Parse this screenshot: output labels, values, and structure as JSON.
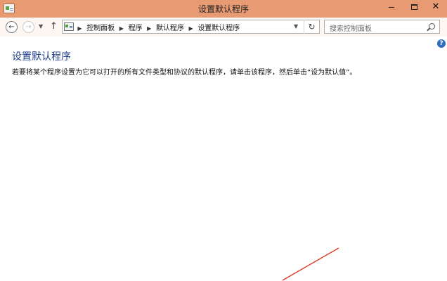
{
  "window": {
    "title": "设置默认程序",
    "minimize_glyph": "",
    "close_glyph": "✕"
  },
  "nav": {
    "back_glyph": "←",
    "forward_glyph": "→",
    "history_dropdown_glyph": "▼",
    "up_glyph": "↑"
  },
  "address": {
    "icon": "control-panel-icon",
    "breadcrumbs": [
      "控制面板",
      "程序",
      "默认程序",
      "设置默认程序"
    ],
    "separator_glyph": "▶",
    "dropdown_glyph": "▼",
    "refresh_glyph": "↻"
  },
  "search": {
    "placeholder": "搜索控制面板"
  },
  "help": {
    "glyph": "?"
  },
  "content": {
    "title": "设置默认程序",
    "description": "若要将某个程序设置为它可以打开的所有文件类型和协议的默认程序，请单击该程序，然后单击“设为默认值”。"
  },
  "colors": {
    "titlebar": "#e89a73",
    "link_title": "#1e3e8a",
    "annotation": "#e03a2a"
  }
}
